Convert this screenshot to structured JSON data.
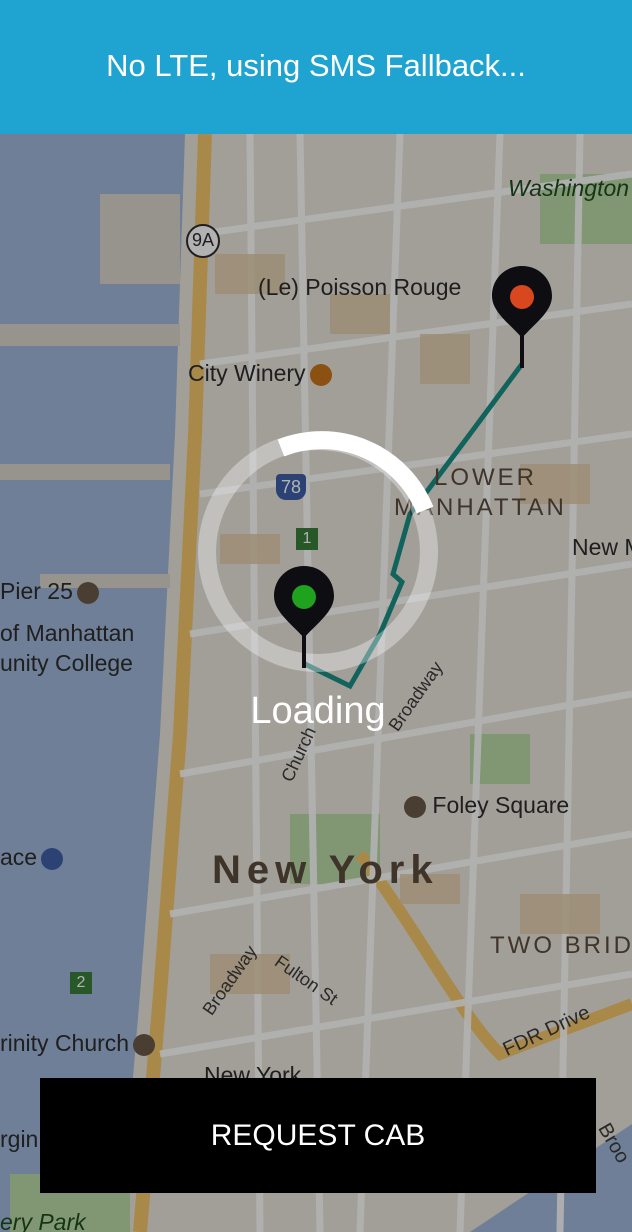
{
  "banner": {
    "message": "No LTE, using SMS Fallback..."
  },
  "map": {
    "labels": {
      "washington_square_park": "Washington Square Park",
      "poisson_rouge": "(Le) Poisson Rouge",
      "city_winery": "City Winery",
      "lower_manhattan_1": "LOWER",
      "lower_manhattan_2": "MANHATTAN",
      "new_m": "New M",
      "pier_25": "Pier 25",
      "bmcc_1": "of Manhattan",
      "bmcc_2": "unity College",
      "broadway": "Broadway",
      "church": "Church",
      "foley_square": "Foley Square",
      "new_york": "New York",
      "ace": "ace",
      "two_bridges": "TWO BRID",
      "fulton_st": "Fulton St",
      "broadway_2": "Broadway",
      "trinity_church": "rinity Church",
      "new_york_small": "New York",
      "fdr_drive": "FDR Drive",
      "brooklyn_edge": "Broo",
      "battery_park": "ery Park",
      "virgin": "rgin",
      "route_9a": "9A",
      "route_78": "78",
      "route_1": "1",
      "route_2": "2"
    },
    "route_color": "#1c8f86",
    "origin_pin_color": "#1fa31f",
    "destination_pin_color": "#d8471d"
  },
  "loader": {
    "text": "Loading"
  },
  "actions": {
    "request_cab": "REQUEST CAB"
  }
}
